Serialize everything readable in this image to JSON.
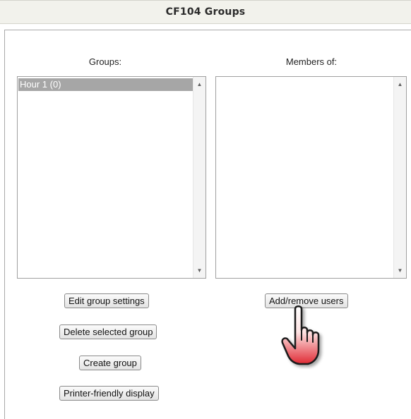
{
  "page": {
    "title": "CF104 Groups"
  },
  "groups_column": {
    "heading": "Groups:",
    "items": [
      {
        "label": "Hour 1 (0)",
        "selected": true
      }
    ],
    "buttons": {
      "edit": "Edit group settings",
      "delete": "Delete selected group",
      "create": "Create group",
      "printer": "Printer-friendly display"
    }
  },
  "members_column": {
    "heading": "Members of:",
    "items": [],
    "buttons": {
      "add_remove": "Add/remove users"
    }
  },
  "icons": {
    "cursor": "pointing-hand-icon",
    "scroll_up": "scroll-up-arrow-icon",
    "scroll_down": "scroll-down-arrow-icon"
  },
  "colors": {
    "selected_item_bg": "#a6a6a6",
    "title_bar_bg": "#f2f2ec",
    "cursor_fill": "#e8323a"
  }
}
